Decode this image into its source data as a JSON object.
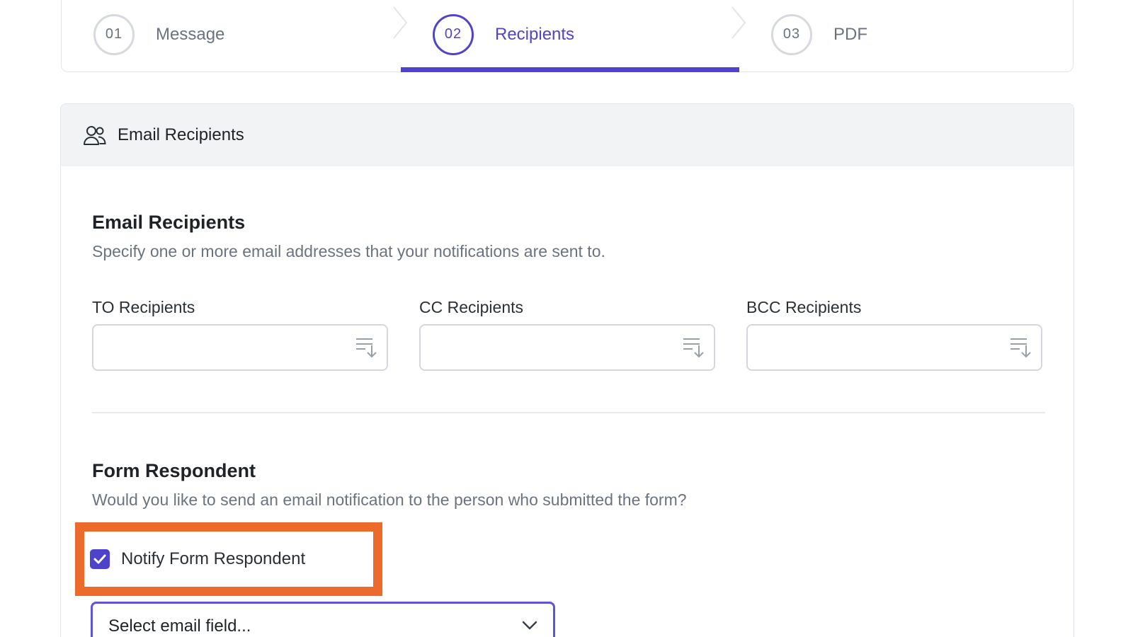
{
  "stepper": {
    "steps": [
      {
        "number": "01",
        "label": "Message"
      },
      {
        "number": "02",
        "label": "Recipients"
      },
      {
        "number": "03",
        "label": "PDF"
      }
    ],
    "active_step": "02",
    "accent_color": "#4f42cd"
  },
  "card": {
    "header_icon": "users-icon",
    "header_title": "Email Recipients"
  },
  "email_recipients": {
    "title": "Email Recipients",
    "description": "Specify one or more email addresses that your notifications are sent to.",
    "fields": [
      {
        "label": "TO Recipients",
        "value": "",
        "icon": "sort-list-icon"
      },
      {
        "label": "CC Recipients",
        "value": "",
        "icon": "sort-list-icon"
      },
      {
        "label": "BCC Recipients",
        "value": "",
        "icon": "sort-list-icon"
      }
    ]
  },
  "form_respondent": {
    "title": "Form Respondent",
    "description": "Would you like to send an email notification to the person who submitted the form?",
    "notify_label": "Notify Form Respondent",
    "notify_checked": true,
    "highlight_color": "#ec6a2c",
    "select_value": "Select email field...",
    "select_icon": "chevron-down-icon"
  }
}
